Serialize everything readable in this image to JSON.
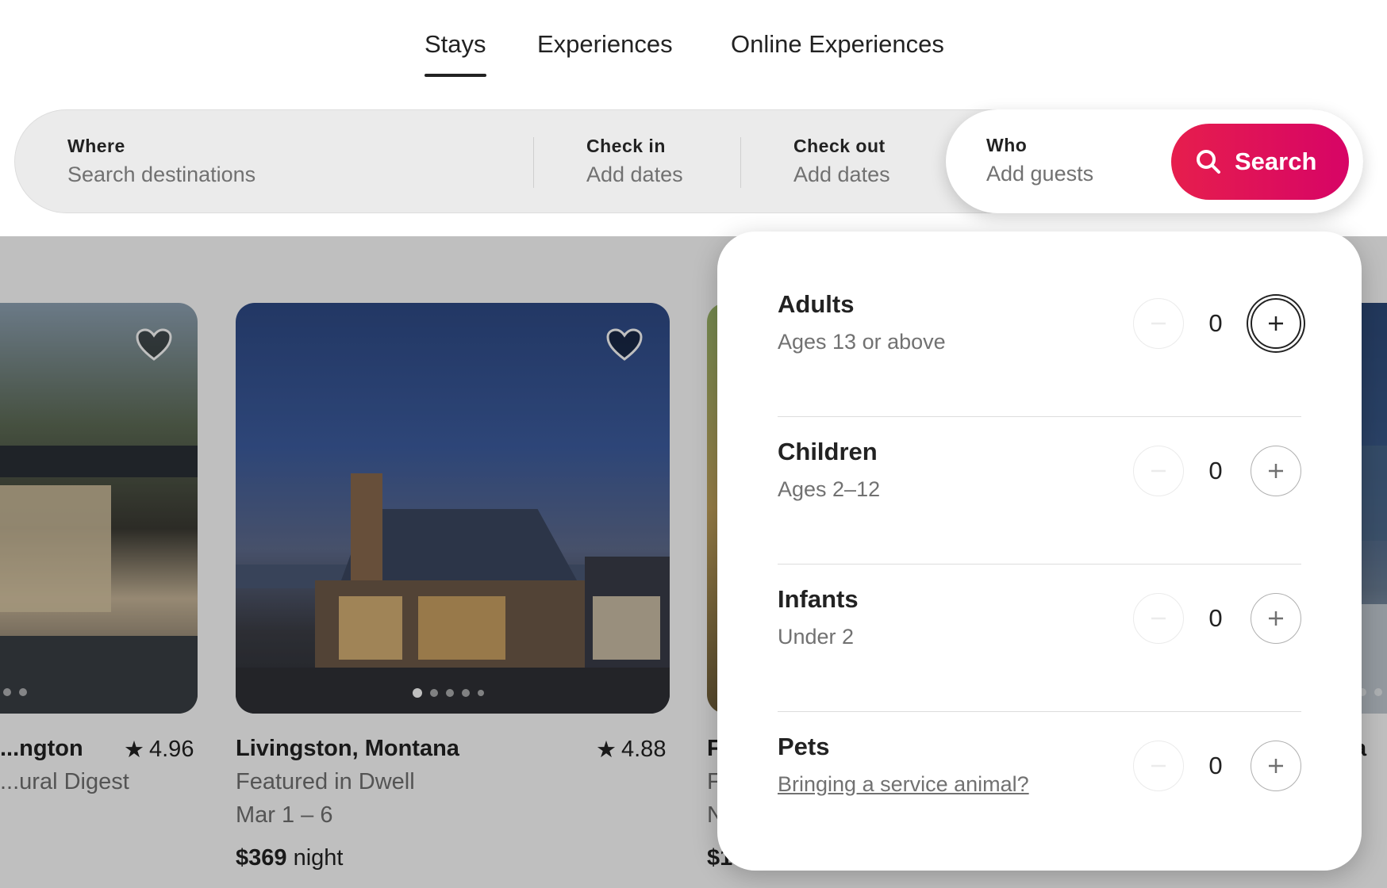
{
  "nav": {
    "tabs": [
      {
        "label": "Stays",
        "active": true
      },
      {
        "label": "Experiences",
        "active": false
      },
      {
        "label": "Online Experiences",
        "active": false
      }
    ]
  },
  "search": {
    "where": {
      "label": "Where",
      "placeholder": "Search destinations"
    },
    "check_in": {
      "label": "Check in",
      "value": "Add dates"
    },
    "check_out": {
      "label": "Check out",
      "value": "Add dates"
    },
    "who": {
      "label": "Who",
      "value": "Add guests"
    },
    "button_label": "Search",
    "button_color": "#e61e4d",
    "search_icon": "search-icon"
  },
  "listings": [
    {
      "title": "...ngton",
      "subtitle": "...ural Digest",
      "rating": "4.96"
    },
    {
      "title": "Livingston, Montana",
      "subtitle": "Featured in Dwell",
      "dates": "Mar 1 – 6",
      "price": "$369",
      "price_unit": "night",
      "rating": "4.88"
    },
    {
      "title": "F",
      "subtitle": "F",
      "dates": "N",
      "price": "$1"
    },
    {
      "title": "a"
    }
  ],
  "guests": {
    "rows": [
      {
        "title": "Adults",
        "subtitle": "Ages 13 or above",
        "count": "0"
      },
      {
        "title": "Children",
        "subtitle": "Ages 2–12",
        "count": "0"
      },
      {
        "title": "Infants",
        "subtitle": "Under 2",
        "count": "0"
      },
      {
        "title": "Pets",
        "link": "Bringing a service animal?",
        "count": "0"
      }
    ]
  }
}
